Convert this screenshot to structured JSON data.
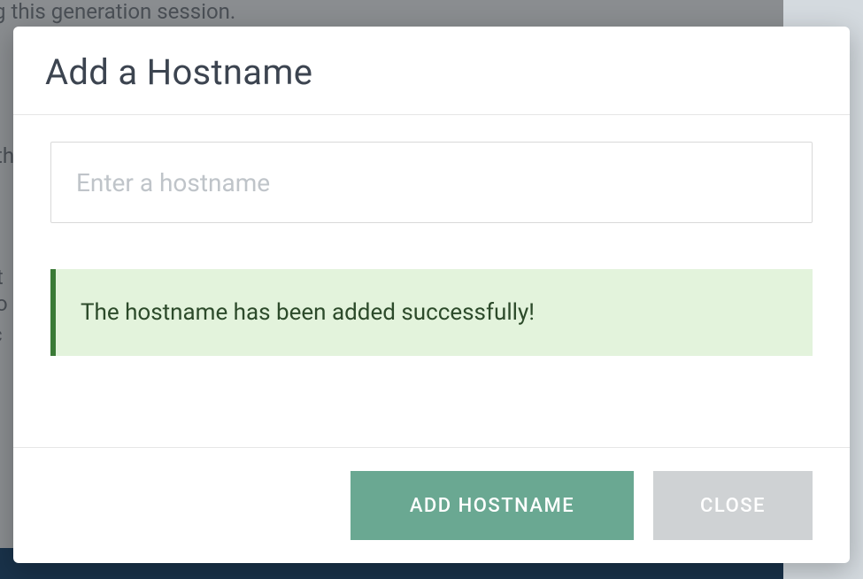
{
  "modal": {
    "title": "Add a Hostname",
    "input": {
      "placeholder": "Enter a hostname",
      "value": ""
    },
    "alert": {
      "message": "The hostname has been added successfully!"
    },
    "buttons": {
      "add": "ADD HOSTNAME",
      "close": "CLOSE"
    }
  },
  "backdrop": {
    "text1": "iring this generation session.",
    "text2": "th",
    "text3": "it",
    "text4": "o",
    "text5": "c"
  }
}
